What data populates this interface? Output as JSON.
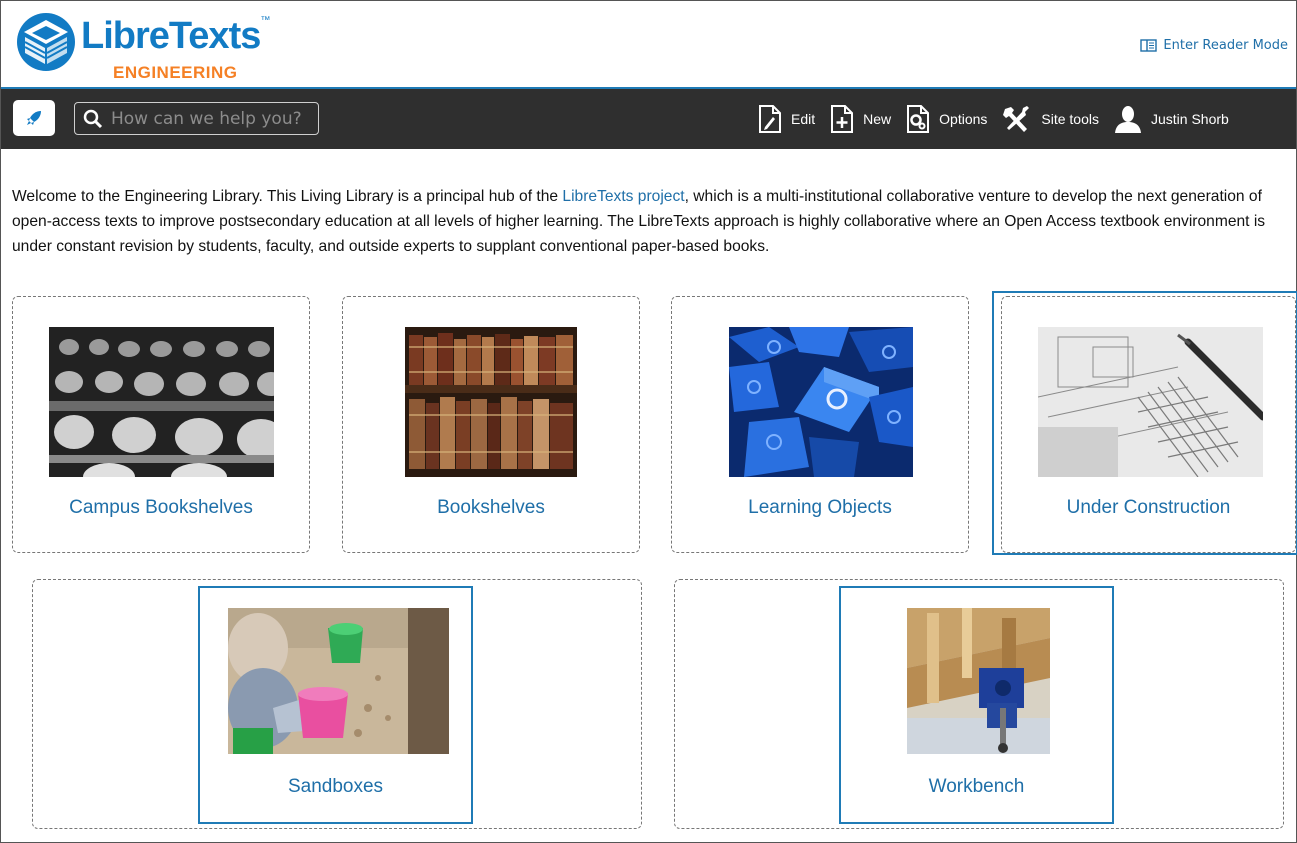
{
  "brand": {
    "name": "LibreTexts",
    "tm": "™",
    "subtitle": "ENGINEERING",
    "colors": {
      "blue": "#127bc4",
      "orange": "#f58025"
    }
  },
  "reader_mode": {
    "label": "Enter Reader Mode",
    "icon": "reader-icon"
  },
  "toolbar": {
    "search_placeholder": "How can we help you?",
    "items": [
      {
        "label": "Edit",
        "icon": "edit-icon"
      },
      {
        "label": "New",
        "icon": "new-page-icon"
      },
      {
        "label": "Options",
        "icon": "options-icon"
      },
      {
        "label": "Site tools",
        "icon": "site-tools-icon"
      },
      {
        "label": "Justin Shorb",
        "icon": "user-icon"
      }
    ]
  },
  "welcome": {
    "before": "Welcome to the Engineering Library. This Living Library is a principal hub of the ",
    "link": "LibreTexts project",
    "after": ", which is a multi-institutional collaborative venture to develop the next generation of open-access texts to improve postsecondary education at all levels of higher learning. The LibreTexts approach is highly collaborative where an Open Access textbook environment is under constant revision by students, faculty, and outside experts to supplant conventional paper-based books."
  },
  "cards": [
    {
      "label": "Campus Bookshelves"
    },
    {
      "label": "Bookshelves"
    },
    {
      "label": "Learning Objects"
    },
    {
      "label": "Under Construction"
    },
    {
      "label": "Sandboxes"
    },
    {
      "label": "Workbench"
    }
  ]
}
